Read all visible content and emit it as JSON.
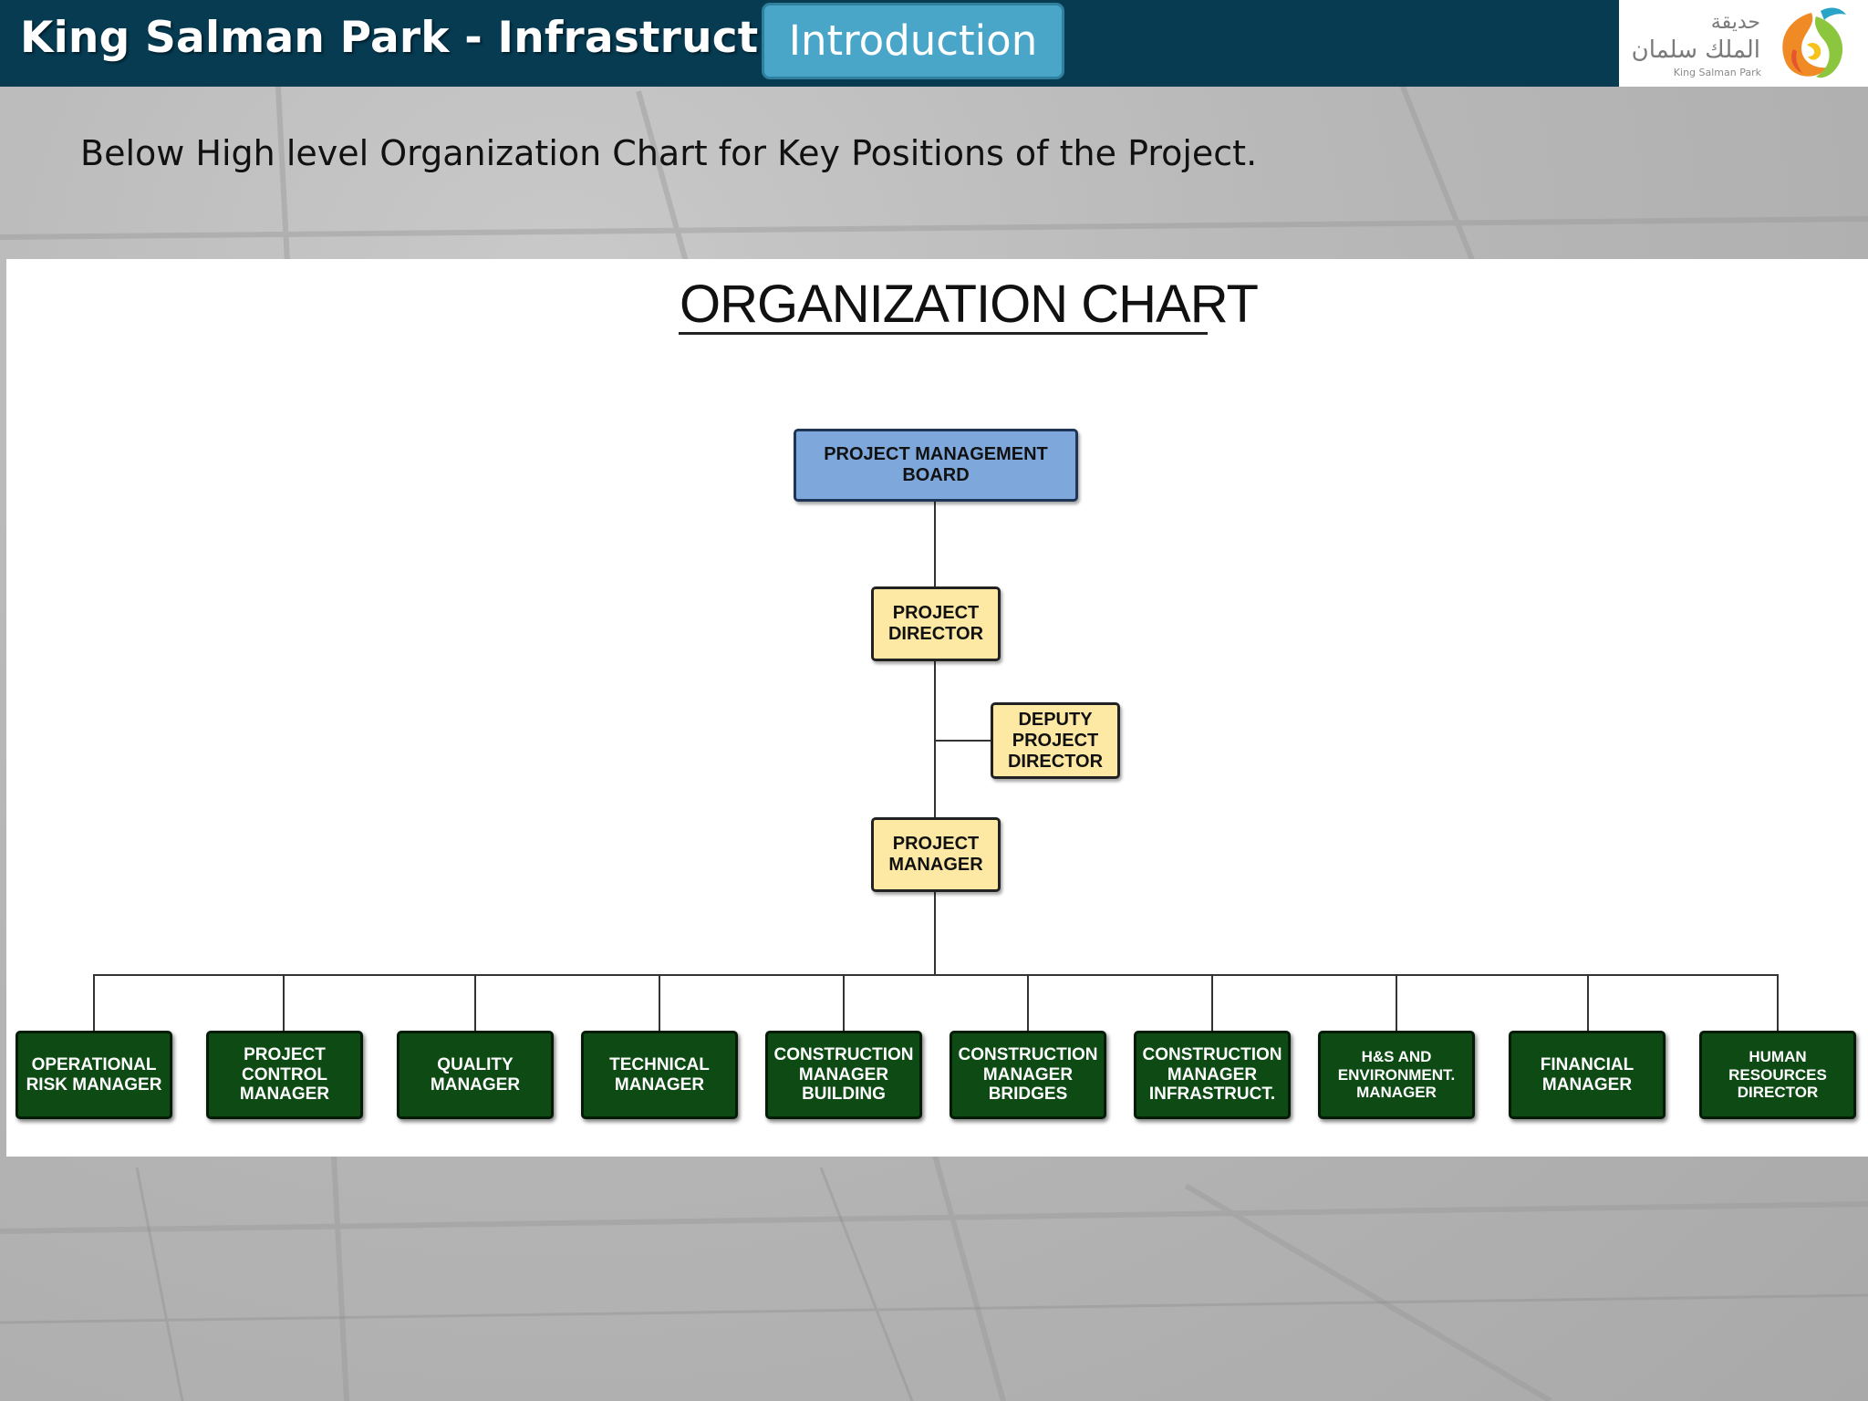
{
  "header": {
    "title": "King Salman Park - Infrastructure",
    "intro_label": "Introduction",
    "logo_arabic_line1": "حديقة",
    "logo_arabic_line2": "الملك سلمان",
    "logo_english": "King Salman Park"
  },
  "subtitle": "Below High level Organization Chart for Key Positions of the Project.",
  "colors": {
    "header_bg": "#063b52",
    "intro_bg": "#4aa6c9",
    "board_box": "#7ea8dc",
    "director_box": "#fde9a3",
    "manager_box": "#0d4a14"
  },
  "org_chart": {
    "title": "ORGANIZATION CHART",
    "board": "PROJECT MANAGEMENT BOARD",
    "project_director": "PROJECT\nDIRECTOR",
    "deputy_director": "DEPUTY\nPROJECT\nDIRECTOR",
    "project_manager": "PROJECT\nMANAGER",
    "managers": [
      "OPERATIONAL\nRISK  MANAGER",
      "PROJECT\nCONTROL\nMANAGER",
      "QUALITY\nMANAGER",
      "TECHNICAL\nMANAGER",
      "CONSTRUCTION\nMANAGER\nBUILDING",
      "CONSTRUCTION\nMANAGER\nBRIDGES",
      "CONSTRUCTION\nMANAGER\nINFRASTRUCT.",
      "H&S AND\nENVIRONMENT.\nMANAGER",
      "FINANCIAL\nMANAGER",
      "HUMAN\nRESOURCES\nDIRECTOR"
    ]
  }
}
